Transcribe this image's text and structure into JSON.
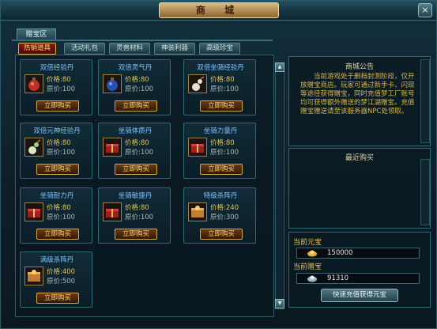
{
  "window": {
    "title": "商 城",
    "close_label": "×"
  },
  "zone_tab": "赠宝区",
  "category_tabs": [
    "热销道具",
    "活动礼包",
    "灵兽材料",
    "神装利器",
    "高级珍宝"
  ],
  "active_tab": 0,
  "items": [
    {
      "name": "双倍经验丹",
      "price_label": "价格:80",
      "orig_label": "原价:100",
      "buy_label": "立即购买",
      "icon": "red-potion-icon"
    },
    {
      "name": "双倍灵气丹",
      "price_label": "价格:80",
      "orig_label": "原价:100",
      "buy_label": "立即购买",
      "icon": "blue-potion-icon"
    },
    {
      "name": "双倍坐骑经验丹",
      "price_label": "价格:80",
      "orig_label": "原价:100",
      "buy_label": "立即购买",
      "icon": "gourd-icon"
    },
    {
      "name": "双倍元神经验丹",
      "price_label": "价格:80",
      "orig_label": "原价:100",
      "buy_label": "立即购买",
      "icon": "green-gourd-icon"
    },
    {
      "name": "坐骑体质丹",
      "price_label": "价格:80",
      "orig_label": "原价:100",
      "buy_label": "立即购买",
      "icon": "red-gift-icon"
    },
    {
      "name": "坐骑力量丹",
      "price_label": "价格:80",
      "orig_label": "原价:100",
      "buy_label": "立即购买",
      "icon": "red-gift-icon"
    },
    {
      "name": "坐骑耐力丹",
      "price_label": "价格:80",
      "orig_label": "原价:100",
      "buy_label": "立即购买",
      "icon": "red-gift-icon"
    },
    {
      "name": "坐骑敏捷丹",
      "price_label": "价格:80",
      "orig_label": "原价:100",
      "buy_label": "立即购买",
      "icon": "red-gift-icon"
    },
    {
      "name": "特级杀阵丹",
      "price_label": "价格:240",
      "orig_label": "原价:300",
      "buy_label": "立即购买",
      "icon": "gold-box-icon"
    },
    {
      "name": "满级杀阵丹",
      "price_label": "价格:400",
      "orig_label": "原价:500",
      "buy_label": "立即购买",
      "icon": "gold-box-icon"
    }
  ],
  "notice": {
    "title": "商城公告",
    "text": "当前游戏处于删档封测阶段，仅开放赠宝商店。玩家可通过新手卡、闪现等途径获得赠宝，同时充值梦工厂账号均可获得额外赠送的梦江湖赠宝。充值赠宝赠送请至该服务器NPC处领取。"
  },
  "recent": {
    "title": "最近购买"
  },
  "currency": {
    "yuanbao_label": "当前元宝",
    "yuanbao_value": "150000",
    "zengbao_label": "当前赠宝",
    "zengbao_value": "91310",
    "recharge_label": "快速充值获得元宝"
  },
  "colors": {
    "accent": "#d3a64e",
    "name_text": "#7fc2ff",
    "price_text": "#e0c060",
    "notice_text": "#d7b64a"
  }
}
